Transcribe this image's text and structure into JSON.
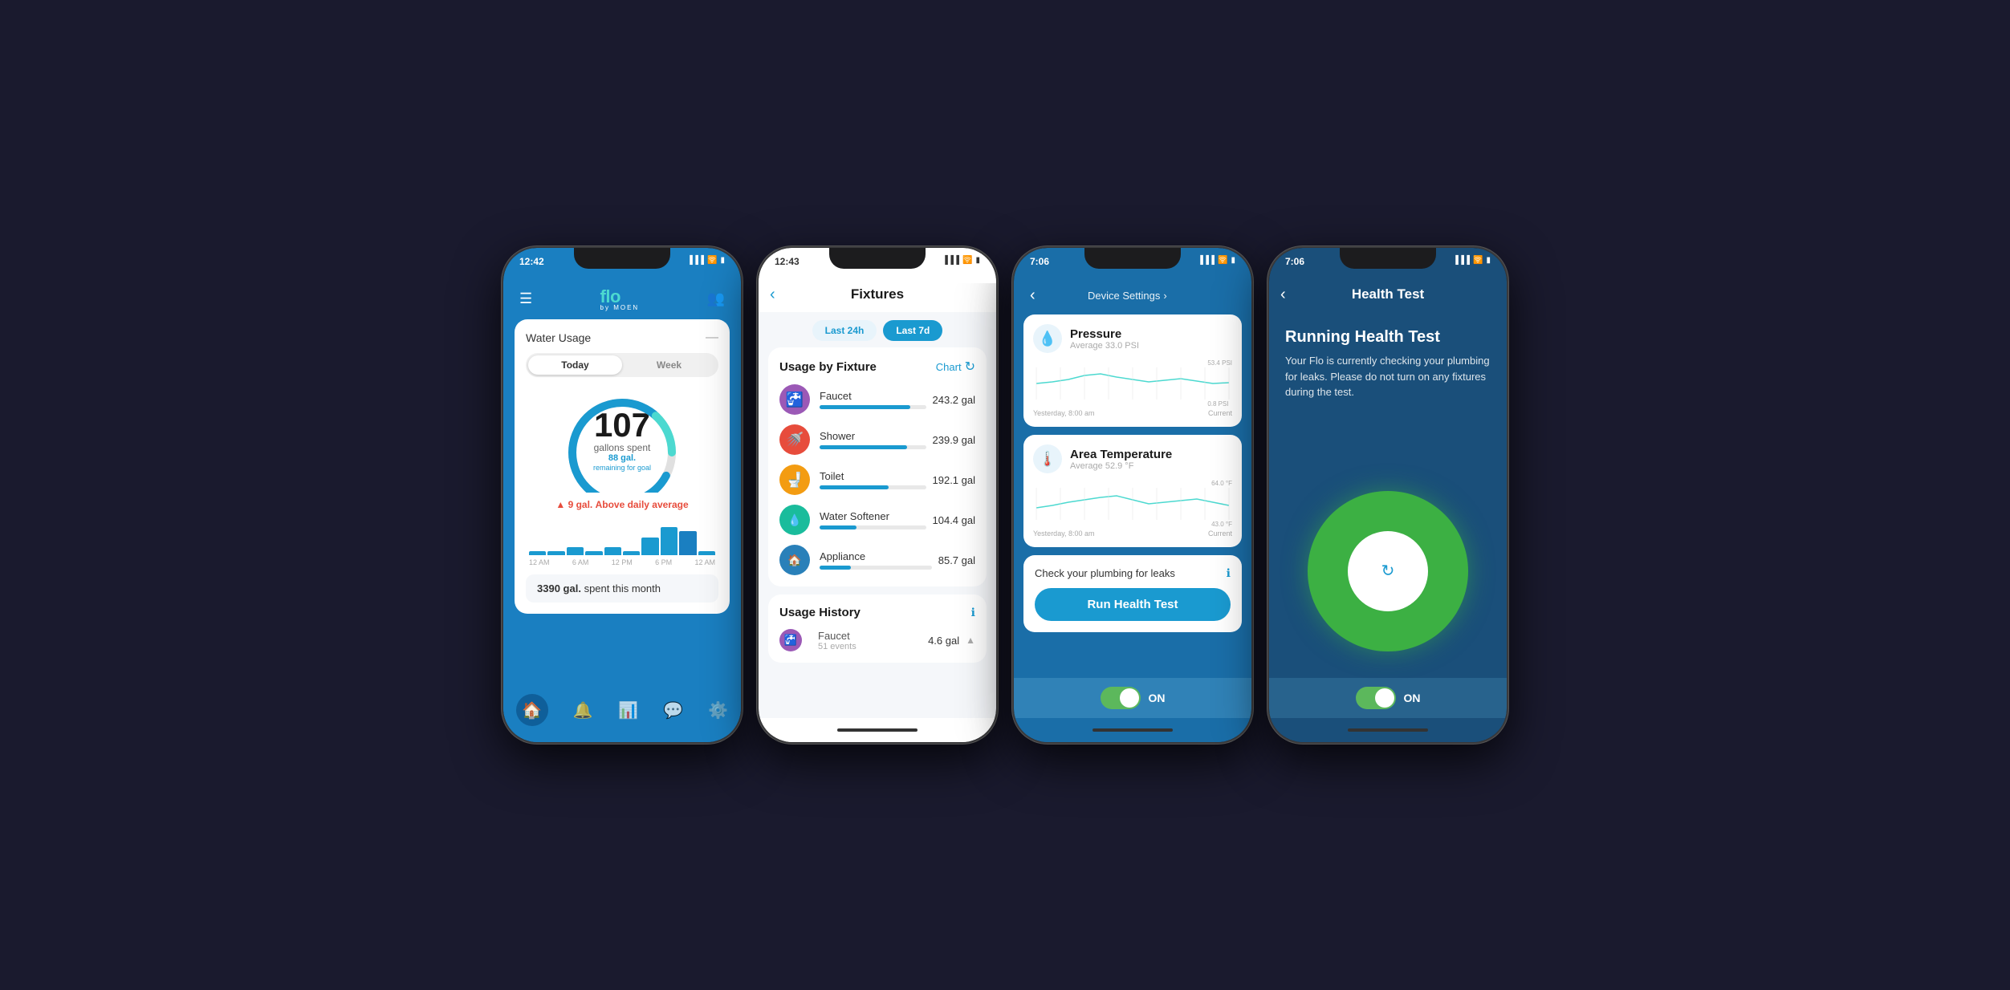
{
  "phone1": {
    "status_time": "12:42",
    "logo_text": "fl",
    "logo_accent": "o",
    "logo_sub": "by MOEN",
    "toggle_today": "Today",
    "toggle_week": "Week",
    "card_title": "Water Usage",
    "gallons_number": "107",
    "gallons_label": "gallons spent",
    "remaining_label": "88 gal.",
    "remaining_sub": "remaining for goal",
    "daily_avg_text": "9 gal.",
    "daily_avg_suffix": " Above daily average",
    "chart_labels": [
      "12 AM",
      "6 AM",
      "12 PM",
      "6 PM",
      "12 AM"
    ],
    "monthly_gal": "3390 gal.",
    "monthly_suffix": " spent this month"
  },
  "phone2": {
    "status_time": "12:43",
    "screen_title": "Fixtures",
    "filter_24h": "Last 24h",
    "filter_7d": "Last 7d",
    "usage_by_fixture_title": "Usage by Fixture",
    "chart_label": "Chart",
    "fixtures": [
      {
        "name": "Faucet",
        "gal": "243.2 gal",
        "color": "purple",
        "icon": "🚰",
        "bar_pct": 85
      },
      {
        "name": "Shower",
        "gal": "239.9 gal",
        "color": "red",
        "icon": "🚿",
        "bar_pct": 82
      },
      {
        "name": "Toilet",
        "gal": "192.1 gal",
        "color": "orange",
        "icon": "🚽",
        "bar_pct": 65
      },
      {
        "name": "Water Softener",
        "gal": "104.4 gal",
        "color": "teal",
        "icon": "💧",
        "bar_pct": 35
      },
      {
        "name": "Appliance",
        "gal": "85.7 gal",
        "color": "blue-dark",
        "icon": "🏠",
        "bar_pct": 28
      }
    ],
    "history_title": "Usage History",
    "history_faucet_name": "Faucet",
    "history_faucet_events": "51 events",
    "history_faucet_gal": "4.6 gal"
  },
  "phone3": {
    "status_time": "7:06",
    "device_settings_label": "Device Settings",
    "pressure_title": "Pressure",
    "pressure_avg": "Average 33.0 PSI",
    "pressure_high": "53.4 PSI",
    "pressure_low": "0.8 PSI",
    "pressure_start": "Yesterday, 8:00 am",
    "pressure_end": "Current",
    "temp_title": "Area Temperature",
    "temp_avg": "Average 52.9 °F",
    "temp_high": "64.0 °F",
    "temp_low": "43.0 °F",
    "temp_start": "Yesterday, 8:00 am",
    "temp_end": "Current",
    "health_check_label": "Check your plumbing for leaks",
    "run_health_btn": "Run Health Test",
    "on_label": "ON"
  },
  "phone4": {
    "status_time": "7:06",
    "screen_title": "Health Test",
    "running_title": "Running Health Test",
    "running_desc": "Your Flo is currently checking your plumbing for leaks. Please do not turn on any fixtures during the test.",
    "on_label": "ON"
  }
}
